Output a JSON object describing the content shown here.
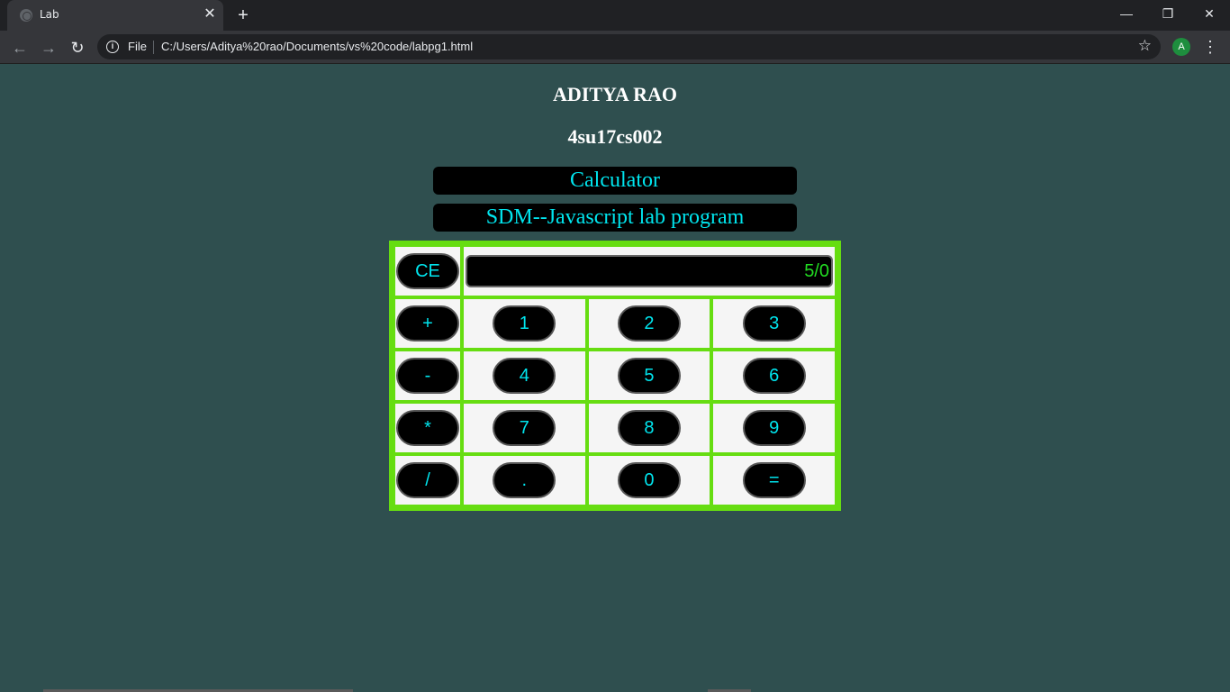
{
  "browser": {
    "tab_title": "Lab",
    "scheme_label": "File",
    "url": "C:/Users/Aditya%20rao/Documents/vs%20code/labpg1.html",
    "profile_initial": "A"
  },
  "page": {
    "name": "ADITYA RAO",
    "usn": "4su17cs002",
    "banner_title": "Calculator",
    "banner_subtitle": "SDM--Javascript lab program"
  },
  "calculator": {
    "display": "5/0",
    "clear_label": "CE",
    "rows": [
      [
        "+",
        "1",
        "2",
        "3"
      ],
      [
        "-",
        "4",
        "5",
        "6"
      ],
      [
        "*",
        "7",
        "8",
        "9"
      ],
      [
        "/",
        ".",
        "0",
        "="
      ]
    ]
  },
  "colors": {
    "page_background": "#2f4f4f",
    "calculator_border": "#66dd11",
    "button_text": "#00e5ee",
    "display_text": "#22dd22"
  }
}
